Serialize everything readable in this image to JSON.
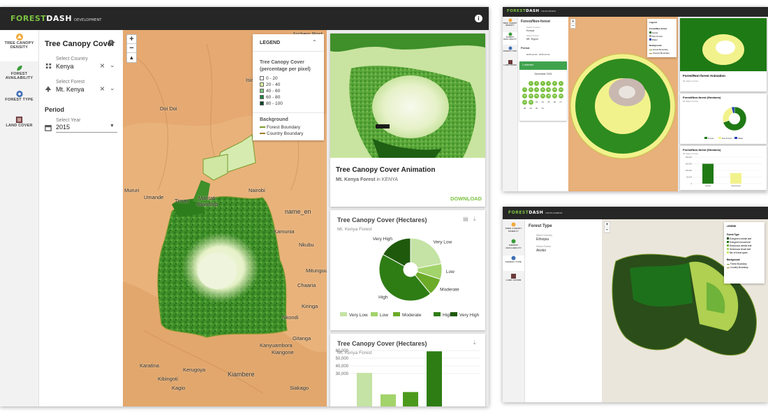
{
  "brand": {
    "forest": "FOREST",
    "dash": "DASH",
    "env": "DEVELOPMENT"
  },
  "main": {
    "nav": [
      {
        "label": "TREE CANOPY DENSITY"
      },
      {
        "label": "FOREST AVAILABILITY"
      },
      {
        "label": "FOREST TYPE"
      },
      {
        "label": "LAND COVER"
      }
    ],
    "panel": {
      "title": "Tree Canopy Cover",
      "country_label": "Select Country",
      "country_value": "Kenya",
      "forest_label": "Select Forest",
      "forest_value": "Mt. Kenya",
      "period_heading": "Period",
      "year_label": "Select Year",
      "year_value": "2015"
    },
    "map": {
      "places": [
        "Archers Post",
        "Isiolo",
        "Doi Doi",
        "Mururi",
        "Umande",
        "Timau",
        "Maritati",
        "Township",
        "Mpari",
        "Rumuruti",
        "Nairobi",
        "Kariua",
        "name_en",
        "Kamunia",
        "Nkubu",
        "Mitunguu",
        "Chaaria",
        "Kiringa",
        "Nkondi",
        "Gitanga",
        "Kanyuambora",
        "Kiangone",
        "Kibingoti",
        "Kagio",
        "Kerugoya",
        "Karatina",
        "Kagumo",
        "Siakago",
        "Kiambere",
        "name_en"
      ]
    },
    "legend": {
      "title": "LEGEND",
      "heading": "Tree Canopy Cover (percentage per pixel)",
      "classes": [
        {
          "label": "0 - 20",
          "color": "#ffffff"
        },
        {
          "label": "20 - 40",
          "color": "#d9f0a3"
        },
        {
          "label": "40 - 60",
          "color": "#78c679"
        },
        {
          "label": "60 - 80",
          "color": "#238443"
        },
        {
          "label": "80 - 100",
          "color": "#004529"
        }
      ],
      "background_heading": "Background",
      "background": [
        {
          "label": "Forest Boundary",
          "color": "#7a9a2a"
        },
        {
          "label": "Country Boundary",
          "color": "#a07b2b"
        }
      ]
    },
    "animation_card": {
      "title": "Tree Canopy Cover Animation",
      "forest": "Mt. Kenya Forest",
      "in": "in",
      "country": "KENYA",
      "download": "DOWNLOAD"
    },
    "donut_card": {
      "title": "Tree Canopy Cover (Hectares)",
      "subtitle": "Mt. Kenya Forest"
    },
    "bar_card": {
      "title": "Tree Canopy Cover (Hectares)",
      "subtitle": "Mt. Kenya Forest"
    }
  },
  "chart_data": [
    {
      "type": "pie",
      "title": "Tree Canopy Cover (Hectares)",
      "categories": [
        "Very Low",
        "Low",
        "Moderate",
        "High",
        "Very High"
      ],
      "values": [
        22,
        8,
        9,
        44,
        17
      ],
      "colors": [
        "#c5e3a5",
        "#a3d36b",
        "#6bab28",
        "#2e7d14",
        "#1f5a0c"
      ],
      "legend": "bottom"
    },
    {
      "type": "bar",
      "title": "Tree Canopy Cover (Hectares)",
      "categories": [
        "Very Low",
        "Low",
        "Moderate",
        "High"
      ],
      "values": [
        31000,
        3000,
        6000,
        59000
      ],
      "colors": [
        "#c5e3a5",
        "#a3d36b",
        "#4c9a1c",
        "#2e7d14"
      ],
      "y_ticks": [
        "60,000",
        "50,000",
        "40,000",
        "30,000"
      ],
      "ylim": [
        0,
        60000
      ],
      "grid": true
    },
    {
      "type": "pie",
      "title": "Forest/Non-forest (Hectares)",
      "categories": [
        "Forest",
        "Non-Forest",
        "Water"
      ],
      "values": [
        70,
        26,
        4
      ],
      "colors": [
        "#1f7a14",
        "#f2f28c",
        "#1f3fb0"
      ],
      "legend": "bottom"
    },
    {
      "type": "bar",
      "title": "Forest/Non-forest (Hectares)",
      "categories": [
        "Forest",
        "Non-Forest"
      ],
      "values": [
        150000,
        80000
      ],
      "colors": [
        "#1f7a14",
        "#f2f28c"
      ],
      "ylim": [
        0,
        200000
      ],
      "grid": true
    }
  ],
  "tr": {
    "nav": [
      "TREE CANOPY DENSITY",
      "FOREST AVAILABILITY",
      "FOREST TYPE",
      "LAND COVER"
    ],
    "panel_title": "Forest/Non-forest",
    "country_label": "Select Country",
    "country_value": "Kenya",
    "forest_label": "Select Forest",
    "forest_value": "Mt. Elgon",
    "period_heading": "Period",
    "period_value": "2015-12-01 - 2015-12-31",
    "selected": "1 selected",
    "calendar_month": "December 2015",
    "calendar_days": [
      "1",
      "2",
      "3",
      "4",
      "5",
      "6",
      "7",
      "8",
      "9",
      "10",
      "11",
      "12",
      "13",
      "14",
      "15",
      "16",
      "17",
      "18",
      "19",
      "20",
      "21",
      "22",
      "23",
      "24",
      "25",
      "26",
      "27",
      "28",
      "29",
      "30",
      "31"
    ],
    "legend_title": "Legend",
    "legend_heading": "Forest/Non-forest",
    "legend_items": [
      {
        "label": "Forest",
        "color": "#1f7a14"
      },
      {
        "label": "Non-Forest",
        "color": "#f2f28c"
      },
      {
        "label": "Water",
        "color": "#1f3fb0"
      }
    ],
    "legend_bg_heading": "Background",
    "legend_bg": [
      {
        "label": "Forest Boundary",
        "color": "#7a9a2a"
      },
      {
        "label": "Country Boundary",
        "color": "#a07b2b"
      }
    ],
    "card_title": "Forest/Non-forest Animation",
    "card_sub": "Mt. Elgon Forest",
    "donut_title": "Forest/Non-forest (Hectares)",
    "donut_sub": "Mt. Elgon Forest",
    "bar_title": "Forest/Non-forest (Hectares)",
    "bar_sub": "Mt. Elgon Forest",
    "bar_ticks": [
      "200,000",
      "150,000",
      "100,000",
      "50,000",
      "0"
    ],
    "bar_cats": [
      "Forest",
      "Non-Forest"
    ]
  },
  "br": {
    "nav": [
      "TREE CANOPY DENSITY",
      "FOREST AVAILABILITY",
      "FOREST TYPE",
      "LAND COVER"
    ],
    "panel_title": "Forest Type",
    "country_label": "Select Country",
    "country_value": "Ethiopia",
    "forest_label": "Select Forest",
    "forest_value": "Akobo",
    "legend_title": "LEGEND",
    "legend_heading": "Forest Type",
    "legend_items": [
      {
        "label": "Evergreen needle leaf",
        "color": "#0d4d12"
      },
      {
        "label": "Evergreen broad leaf",
        "color": "#1c7a1c"
      },
      {
        "label": "Deciduous needle leaf",
        "color": "#6fb33a"
      },
      {
        "label": "Deciduous broad leaf",
        "color": "#a7d86b"
      },
      {
        "label": "Mix of forest types",
        "color": "#c7e85a"
      }
    ],
    "legend_bg_heading": "Background",
    "legend_bg": [
      {
        "label": "Forest Boundary",
        "color": "#7a9a2a"
      },
      {
        "label": "Country Boundary",
        "color": "#a07b2b"
      }
    ]
  }
}
